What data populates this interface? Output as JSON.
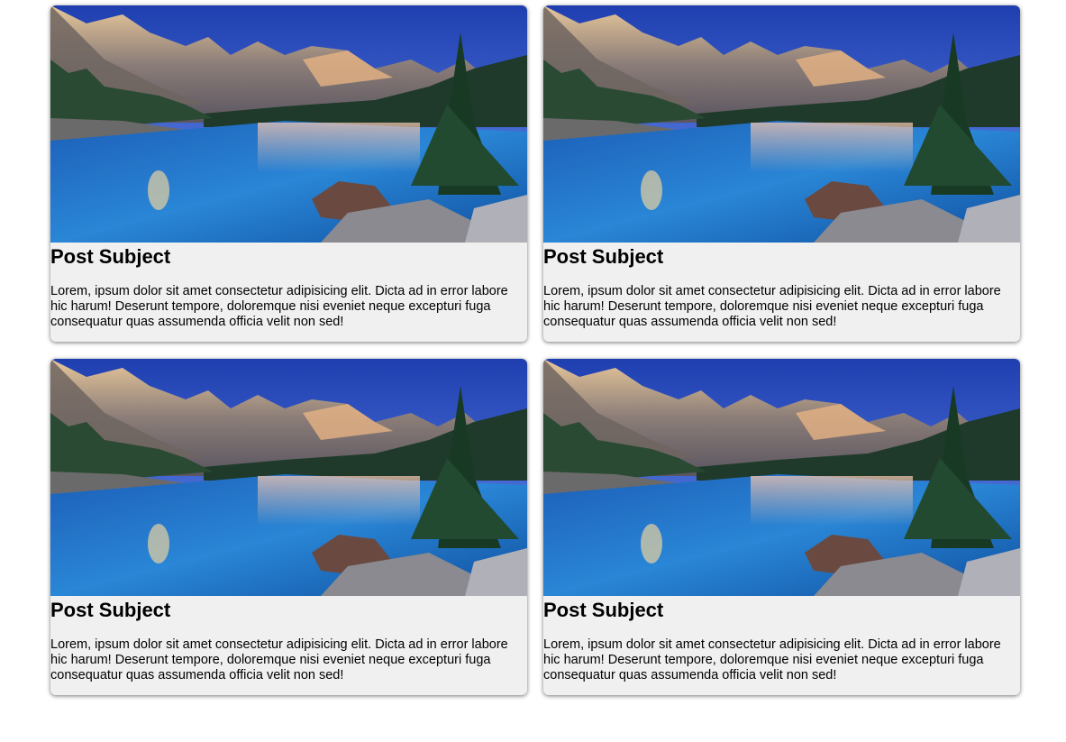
{
  "image_description": "landscape-photo-mountain-lake",
  "posts": [
    {
      "title": "Post Subject",
      "text": "Lorem, ipsum dolor sit amet consectetur adipisicing elit. Dicta ad in error labore hic harum! Deserunt tempore, doloremque nisi eveniet neque excepturi fuga consequatur quas assumenda officia velit non sed!"
    },
    {
      "title": "Post Subject",
      "text": "Lorem, ipsum dolor sit amet consectetur adipisicing elit. Dicta ad in error labore hic harum! Deserunt tempore, doloremque nisi eveniet neque excepturi fuga consequatur quas assumenda officia velit non sed!"
    },
    {
      "title": "Post Subject",
      "text": "Lorem, ipsum dolor sit amet consectetur adipisicing elit. Dicta ad in error labore hic harum! Deserunt tempore, doloremque nisi eveniet neque excepturi fuga consequatur quas assumenda officia velit non sed!"
    },
    {
      "title": "Post Subject",
      "text": "Lorem, ipsum dolor sit amet consectetur adipisicing elit. Dicta ad in error labore hic harum! Deserunt tempore, doloremque nisi eveniet neque excepturi fuga consequatur quas assumenda officia velit non sed!"
    }
  ]
}
